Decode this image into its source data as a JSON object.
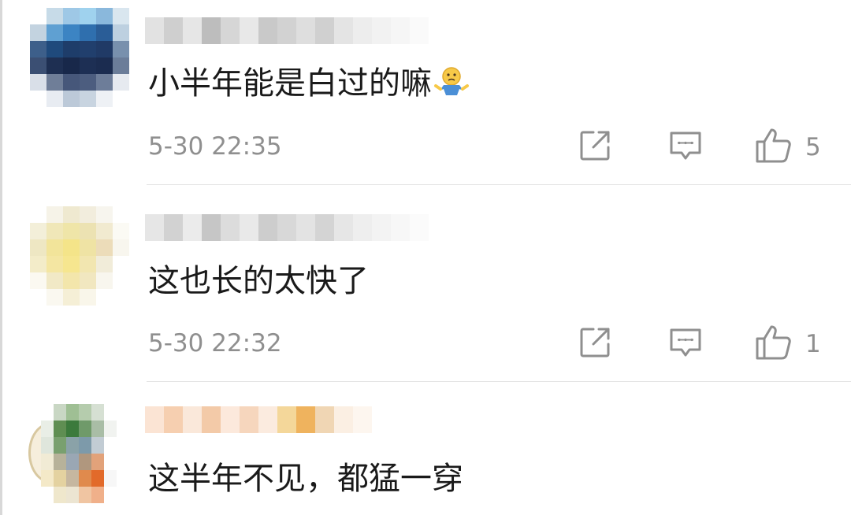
{
  "comments": [
    {
      "text": "小半年能是白过的嘛",
      "emoji": "shrug-emoji",
      "time": "5-30 22:35",
      "likes": "5",
      "avatar_colors": [
        "#ffffff",
        "#c7dbe8",
        "#9ec8e6",
        "#9fd2ee",
        "#8ab8dc",
        "#d9e6ef",
        "#c3d3e0",
        "#5fa0d2",
        "#3c84c3",
        "#2f6fae",
        "#2a5d97",
        "#bdd0e0",
        "#3d5f8a",
        "#1f4a7c",
        "#1e3d6a",
        "#213f6d",
        "#203a66",
        "#7890ad",
        "#3b4f73",
        "#1e2f52",
        "#18284a",
        "#1d2f54",
        "#1b2c50",
        "#6b7d99",
        "#d9dfe8",
        "#6f7e98",
        "#46577a",
        "#4c5d7f",
        "#6d7d99",
        "#e6eaf0",
        "#ffffff",
        "#e8ecf2",
        "#bcc9d8",
        "#c8d4e0",
        "#eef1f5",
        "#ffffff"
      ],
      "name_colors": [
        "#e2e2e2",
        "#cfcfcf",
        "#e6e6e6",
        "#bdbdbd",
        "#d6d6d6",
        "#e8e8e8",
        "#c9c9c9",
        "#d2d2d2",
        "#dedede",
        "#d0d0d0",
        "#e4e4e4",
        "#ededed",
        "#f2f2f2",
        "#f6f6f6",
        "#fafafa"
      ]
    },
    {
      "text": "这也长的太快了",
      "time": "5-30 22:32",
      "likes": "1",
      "avatar_colors": [
        "#ffffff",
        "#f6f3e8",
        "#efe9d0",
        "#f2eddd",
        "#f7f5ee",
        "#ffffff",
        "#f3efd9",
        "#f0e7b8",
        "#efe5a8",
        "#ece2b2",
        "#f1ead0",
        "#fbfaf4",
        "#eee7c3",
        "#f2e49a",
        "#f4e489",
        "#efe3a4",
        "#ecdcb9",
        "#f8f6ee",
        "#f3ecc9",
        "#f4e6a2",
        "#f6e68f",
        "#f2e6b0",
        "#f1ecd9",
        "#ffffff",
        "#fbf9f1",
        "#f1e9c6",
        "#f3e6ab",
        "#f1e7c0",
        "#f8f6ee",
        "#ffffff",
        "#ffffff",
        "#faf8f0",
        "#f5efd6",
        "#f9f6ea",
        "#ffffff",
        "#ffffff"
      ],
      "name_colors": [
        "#e6e6e6",
        "#d2d2d2",
        "#ebebeb",
        "#c6c6c6",
        "#dcdcdc",
        "#e9e9e9",
        "#cdcdcd",
        "#d8d8d8",
        "#e3e3e3",
        "#d4d4d4",
        "#e6e6e6",
        "#eeeeee",
        "#f3f3f3",
        "#f7f7f7",
        "#fbfbfb"
      ]
    },
    {
      "text": "这半年不见，都猛一穿",
      "avatar_colors": [
        "#ffffff",
        "#c9d7c4",
        "#9fbf94",
        "#b5ccad",
        "#d6e0d3",
        "#ffffff",
        "#e9eee6",
        "#5f8e52",
        "#3c7a3c",
        "#6f9a6a",
        "#a9bda6",
        "#f1f3f0",
        "#dfe6dc",
        "#79a06f",
        "#8aa2a8",
        "#7d9aaa",
        "#c2ccd4",
        "#ffffff",
        "#f1ebd5",
        "#b7b29a",
        "#9aa7b4",
        "#b0977e",
        "#e2a27a",
        "#ffffff",
        "#f4e9c8",
        "#e4d2a0",
        "#c6b7a0",
        "#e08a4d",
        "#e26a2a",
        "#f7f7f7",
        "#ffffff",
        "#efe7cc",
        "#ece5d2",
        "#f0c5a2",
        "#f0b08a",
        "#ffffff"
      ],
      "name_colors": [
        "#fbe4d4",
        "#f6cfb0",
        "#fae8da",
        "#f3caa8",
        "#fce9dc",
        "#f6d6bd",
        "#fbebdf",
        "#f4d79a",
        "#efb35e",
        "#f0d6b4",
        "#fbefe3",
        "#fdf6ef"
      ]
    }
  ]
}
